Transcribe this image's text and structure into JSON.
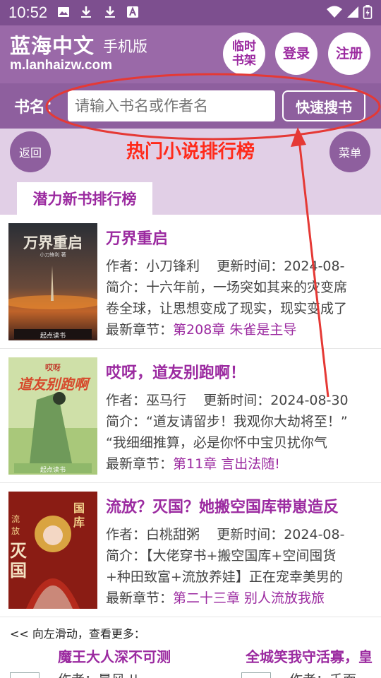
{
  "status_bar": {
    "time": "10:52"
  },
  "header": {
    "site_title": "蓝海中文",
    "site_subtitle": "手机版",
    "domain": "m.lanhaizw.com",
    "temp_shelf_line1": "临时",
    "temp_shelf_line2": "书架",
    "login_label": "登录",
    "register_label": "注册"
  },
  "search": {
    "label": "书名：",
    "placeholder": "请输入书名或作者名",
    "button_label": "快速搜书"
  },
  "nav": {
    "back_label": "返回",
    "title": "热门小说排行榜",
    "menu_label": "菜单"
  },
  "tab": {
    "label": "潜力新书排行榜"
  },
  "books": [
    {
      "title": "万界重启",
      "author_label": "作者：",
      "author": "小刀锋利",
      "update_label": "更新时间：",
      "update": "2024-08-",
      "intro_line1": "简介：十六年前，一场突如其来的灾变席",
      "intro_line2": "卷全球，让思想变成了现实，现实变成了",
      "latest_label": "最新章节：",
      "latest": "第208章 朱雀是主导",
      "cover_text": "万界重启",
      "cover_small": "小刀锋利 著",
      "cover_publisher": "起点读书"
    },
    {
      "title": "哎呀，道友别跑啊！",
      "author_label": "作者：",
      "author": "巫马行",
      "update_label": "更新时间：",
      "update": "2024-08-30",
      "intro_line1": "简介：“道友请留步！我观你大劫将至！”",
      "intro_line2": "“我细细推算，必是你怀中宝贝扰你气",
      "latest_label": "最新章节：",
      "latest": "第11章 言出法随!",
      "cover_text": "道友别跑啊",
      "cover_small": "哎呀",
      "cover_publisher": "起点读书"
    },
    {
      "title": "流放？灭国？她搬空国库带崽造反",
      "author_label": "作者：",
      "author": "白桃甜粥",
      "update_label": "更新时间：",
      "update": "2024-08-",
      "intro_line1": "简介：【大佬穿书+搬空国库+空间囤货",
      "intro_line2": "+种田致富+流放养娃】正在宠幸美男的",
      "latest_label": "最新章节：",
      "latest": "第二十三章 别人流放我旅",
      "cover_text": "灭国",
      "cover_small": "流放",
      "cover_publisher": "国库"
    }
  ],
  "more": {
    "hint": "<< 向左滑动，查看更多：",
    "items": [
      {
        "title": "魔王大人深不可测",
        "author": "作者：晨风 ||"
      },
      {
        "title": "全城笑我守活寡，皇",
        "author": "作者：千面"
      }
    ]
  }
}
